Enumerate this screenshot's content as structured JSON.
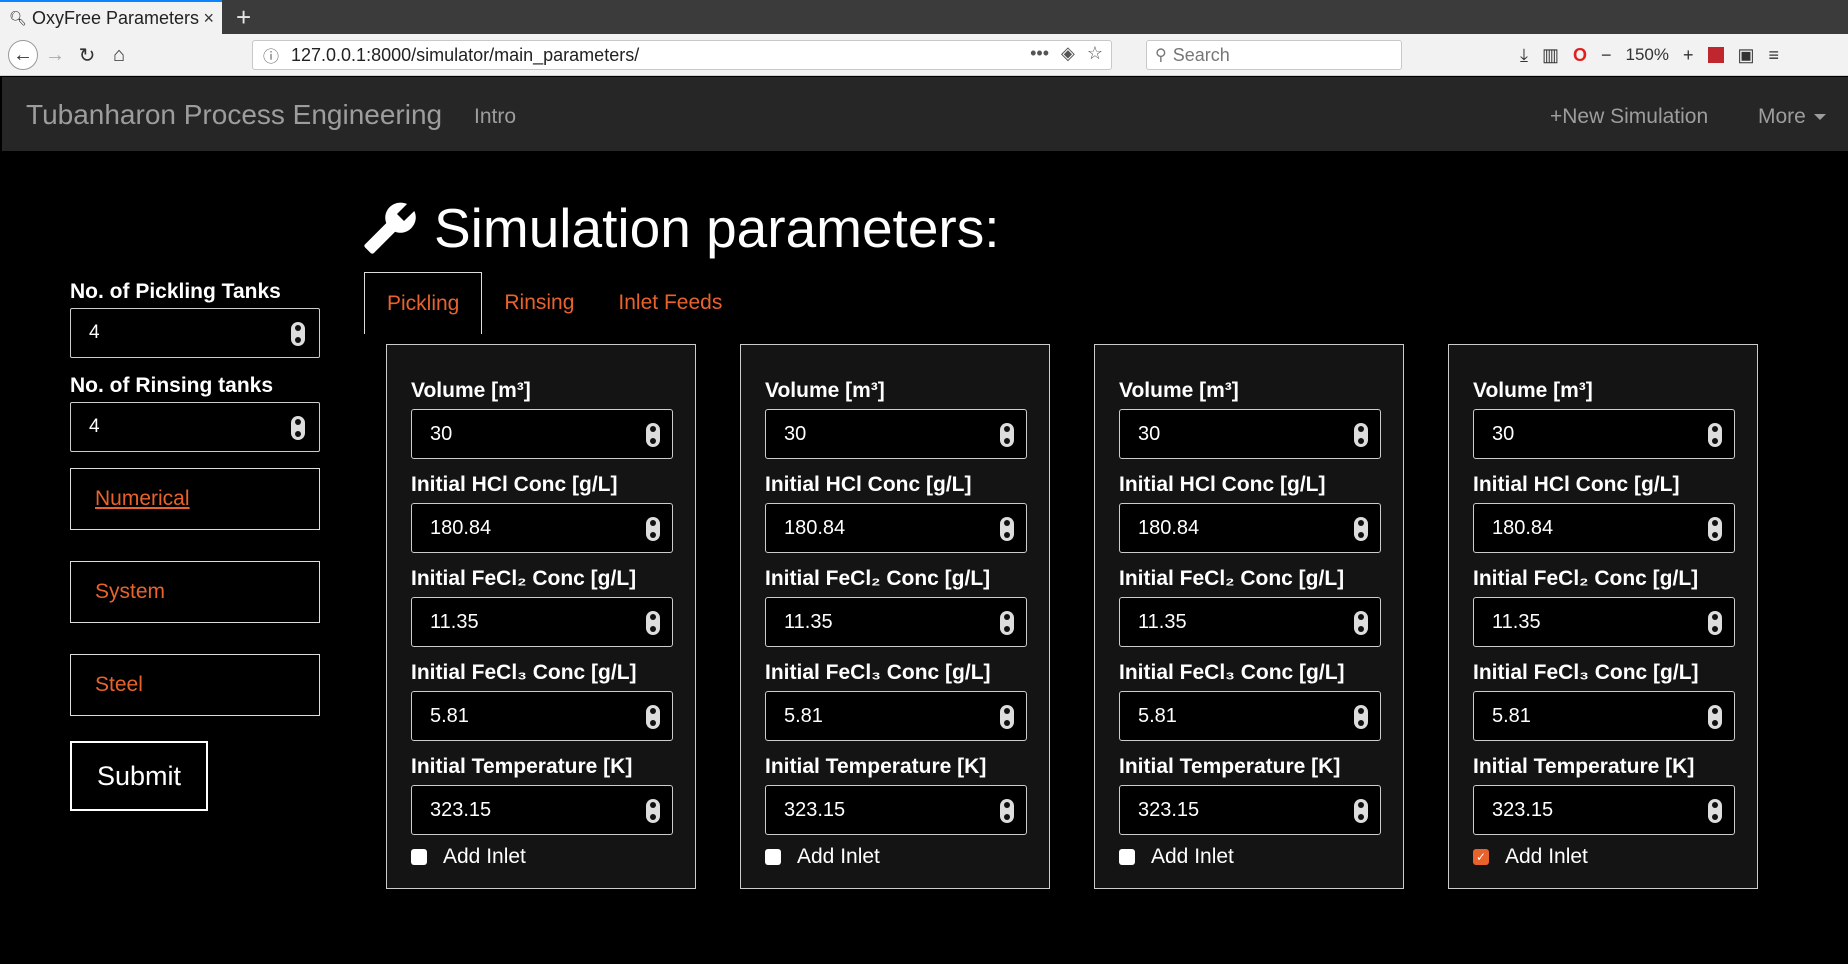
{
  "browser": {
    "tab_title": "OxyFree Parameters",
    "url": "127.0.0.1:8000/simulator/main_parameters/",
    "search_placeholder": "Search",
    "zoom": "150%"
  },
  "navbar": {
    "brand": "Tubanharon Process Engineering",
    "intro": "Intro",
    "new_simulation": "+New Simulation",
    "more": "More"
  },
  "page": {
    "title": "Simulation parameters:"
  },
  "tabs": [
    {
      "label": "Pickling",
      "active": true
    },
    {
      "label": "Rinsing",
      "active": false
    },
    {
      "label": "Inlet Feeds",
      "active": false
    }
  ],
  "sidebar": {
    "pickling_label": "No. of Pickling Tanks",
    "pickling_value": "4",
    "rinsing_label": "No. of Rinsing tanks",
    "rinsing_value": "4",
    "numerical": "Numerical",
    "system": "System",
    "steel": "Steel",
    "submit": "Submit"
  },
  "tank_labels": {
    "volume": "Volume [m³]",
    "hcl": "Initial HCl Conc [g/L]",
    "fecl2": "Initial FeCl₂ Conc [g/L]",
    "fecl3": "Initial FeCl₃ Conc [g/L]",
    "temp": "Initial Temperature [K]",
    "add_inlet": "Add Inlet"
  },
  "tanks": [
    {
      "volume": "30",
      "hcl": "180.84",
      "fecl2": "11.35",
      "fecl3": "5.81",
      "temp": "323.15",
      "add_inlet": false
    },
    {
      "volume": "30",
      "hcl": "180.84",
      "fecl2": "11.35",
      "fecl3": "5.81",
      "temp": "323.15",
      "add_inlet": false
    },
    {
      "volume": "30",
      "hcl": "180.84",
      "fecl2": "11.35",
      "fecl3": "5.81",
      "temp": "323.15",
      "add_inlet": false
    },
    {
      "volume": "30",
      "hcl": "180.84",
      "fecl2": "11.35",
      "fecl3": "5.81",
      "temp": "323.15",
      "add_inlet": true
    }
  ],
  "colors": {
    "accent": "#e8622c",
    "navbar_bg": "#262626",
    "page_bg": "#000000"
  }
}
